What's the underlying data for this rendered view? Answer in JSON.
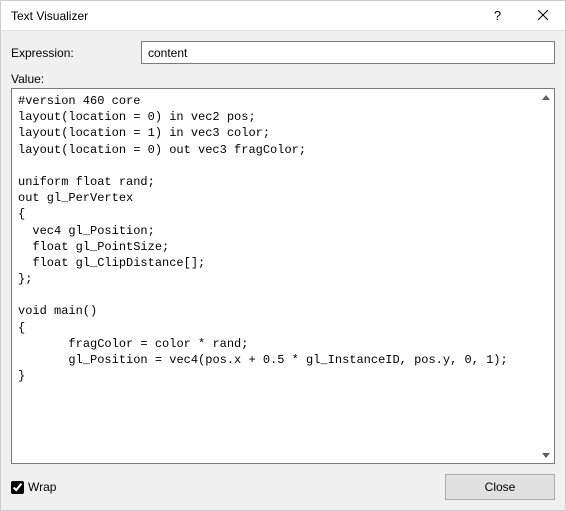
{
  "window": {
    "title": "Text Visualizer",
    "help_symbol": "?",
    "close_symbol": "×"
  },
  "labels": {
    "expression": "Expression:",
    "value": "Value:",
    "wrap": "Wrap",
    "close": "Close"
  },
  "inputs": {
    "expression_value": "content",
    "wrap_checked": true
  },
  "value_text": "#version 460 core\nlayout(location = 0) in vec2 pos;\nlayout(location = 1) in vec3 color;\nlayout(location = 0) out vec3 fragColor;\n\nuniform float rand;\nout gl_PerVertex\n{\n  vec4 gl_Position;\n  float gl_PointSize;\n  float gl_ClipDistance[];\n};\n\nvoid main()\n{\n       fragColor = color * rand;\n       gl_Position = vec4(pos.x + 0.5 * gl_InstanceID, pos.y, 0, 1);\n}"
}
